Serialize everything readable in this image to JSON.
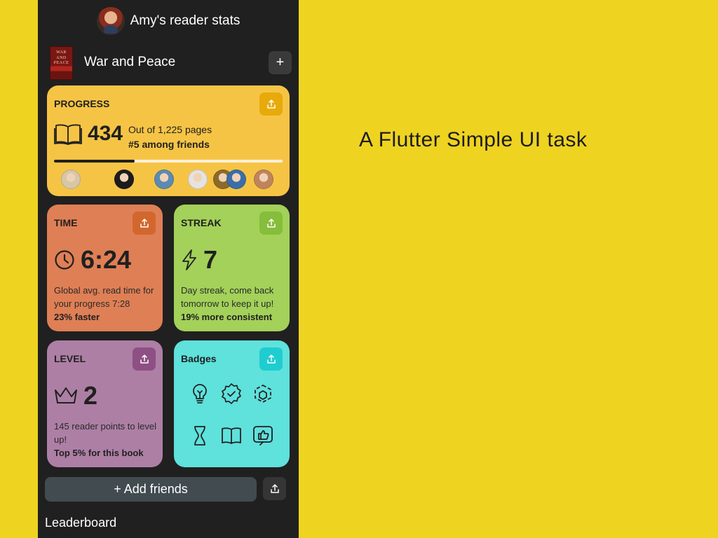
{
  "header": {
    "title": "Amy's reader stats"
  },
  "book": {
    "title": "War and Peace",
    "cover_text": [
      "WAR",
      "AND",
      "PEACE"
    ],
    "add_label": "+"
  },
  "progress": {
    "label": "PROGRESS",
    "pages_read": "434",
    "pages_total_text": "Out of 1,225 pages",
    "rank_text": "#5 among friends",
    "fraction": 0.354
  },
  "time": {
    "label": "TIME",
    "value": "6:24",
    "desc": "Global avg. read time for your progress 7:28",
    "highlight": "23% faster"
  },
  "streak": {
    "label": "STREAK",
    "value": "7",
    "desc": "Day streak, come back tomorrow to keep it up!",
    "highlight": "19% more consistent"
  },
  "level": {
    "label": "LEVEL",
    "value": "2",
    "desc": "145 reader points to level up!",
    "highlight": "Top 5% for this book"
  },
  "badges": {
    "label": "Badges",
    "icons": [
      "lightbulb-icon",
      "verified-badge-icon",
      "cube-scan-icon",
      "hourglass-icon",
      "open-book-icon",
      "thumbs-up-icon"
    ]
  },
  "friends": {
    "avatars": [
      "friend-avatar-1",
      "friend-avatar-2",
      "friend-avatar-3",
      "friend-avatar-4",
      "friend-avatar-5",
      "friend-avatar-6",
      "friend-avatar-7"
    ],
    "colors": [
      "#d7c7a6",
      "#1c1c1c",
      "#5b8bb0",
      "#e6e2df",
      "#8c6a2a",
      "#3a6ea8",
      "#c0845c"
    ]
  },
  "footer": {
    "add_friends_label": "+ Add friends",
    "leaderboard_label": "Leaderboard"
  },
  "tagline": "A Flutter Simple UI task",
  "colors": {
    "background": "#eed321",
    "phone": "#202020",
    "progress_card": "#f6c445",
    "time_card": "#df7f55",
    "streak_card": "#a3d159",
    "level_card": "#ad7fa5",
    "badges_card": "#5fe1dc"
  }
}
